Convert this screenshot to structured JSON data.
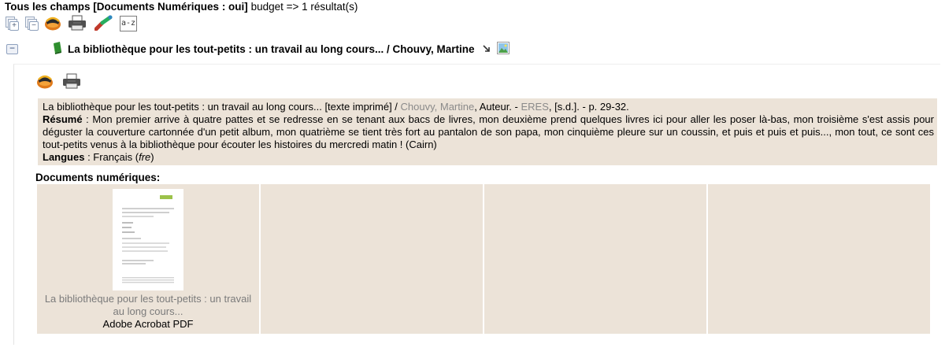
{
  "search": {
    "fields_label": "Tous les champs [Documents Numériques : oui]",
    "query_text": " budget => 1 résultat(s)"
  },
  "toolbar": {
    "icons": [
      "expand-all-icon",
      "collapse-all-icon",
      "basket-icon",
      "print-icon",
      "link-icon",
      "sort-icon"
    ],
    "sort_label": "a-z"
  },
  "record": {
    "toggle_symbol": "−",
    "title": "La bibliothèque pour les tout-petits : un travail au long cours... / Chouvy, Martine",
    "icons": [
      "book-icon",
      "arrow-icon",
      "picture-icon"
    ]
  },
  "notice": {
    "title_text": "La bibliothèque pour les tout-petits : un travail au long cours... [texte imprimé] / ",
    "author": "Chouvy, Martine",
    "author_role": ", Auteur. - ",
    "publisher": "ERES",
    "publisher_suffix": ", [s.d.]. - p. 29-32.",
    "resume_label": "Résumé",
    "resume_text": " : Mon premier arrive à quatre pattes et se redresse en se tenant aux bacs de livres, mon deuxième prend quelques livres ici pour aller les poser là-bas, mon troisième s'est assis pour déguster la couverture cartonnée d'un petit album, mon quatrième se tient très fort au pantalon de son papa, mon cinquième pleure sur un coussin, et puis et puis et puis..., mon tout, ce sont ces tout-petits venus à la bibliothèque pour écouter les histoires du mercredi matin ! (Cairn)",
    "langues_label": "Langues",
    "langues_text": " : Français (",
    "langues_code": "fre",
    "langues_close": ")"
  },
  "documents": {
    "heading": "Documents numériques:",
    "items": [
      {
        "name": "La bibliothèque pour les tout-petits : un travail au long cours...",
        "type": "Adobe Acrobat PDF"
      }
    ]
  },
  "colors": {
    "notice_bg": "#ece3d8",
    "link_gray": "#8a8a8a"
  }
}
